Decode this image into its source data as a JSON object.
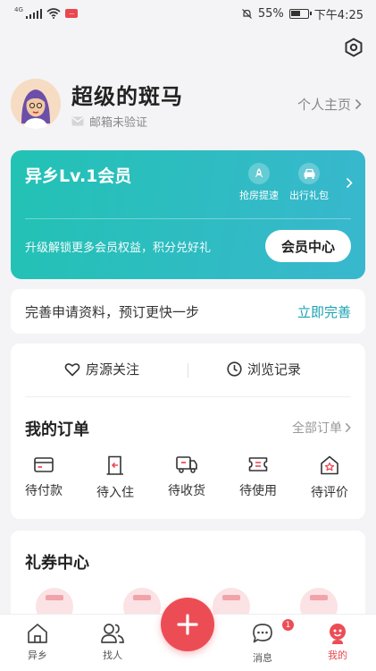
{
  "status_bar": {
    "network": "4G",
    "battery": "55%",
    "time": "下午4:25",
    "app_badge": "—"
  },
  "header": {
    "settings_icon": "hexagon-gear-icon"
  },
  "profile": {
    "nickname": "超级的斑马",
    "email_status": "邮箱未验证",
    "homepage_label": "个人主页"
  },
  "member_card": {
    "title": "异乡Lv.1会员",
    "perks": [
      {
        "label": "抢房提速",
        "icon": "rocket-icon"
      },
      {
        "label": "出行礼包",
        "icon": "car-icon"
      }
    ],
    "subtitle": "升级解锁更多会员权益，积分兑好礼",
    "button_label": "会员中心",
    "colors": {
      "start": "#22c2b4",
      "end": "#39b7ce"
    }
  },
  "profile_completion": {
    "text": "完善申请资料，预订更快一步",
    "action_label": "立即完善",
    "action_color": "#1aa3b4"
  },
  "quick_access": [
    {
      "label": "房源关注",
      "icon": "heart-icon"
    },
    {
      "label": "浏览记录",
      "icon": "clock-icon"
    }
  ],
  "orders": {
    "title": "我的订单",
    "all_label": "全部订单",
    "items": [
      {
        "label": "待付款",
        "icon": "card-icon"
      },
      {
        "label": "待入住",
        "icon": "door-icon"
      },
      {
        "label": "待收货",
        "icon": "truck-icon"
      },
      {
        "label": "待使用",
        "icon": "ticket-icon"
      },
      {
        "label": "待评价",
        "icon": "star-house-icon"
      }
    ]
  },
  "coupons": {
    "title": "礼券中心"
  },
  "tab_bar": {
    "accent": "#ec4d55",
    "tabs": [
      {
        "label": "异乡",
        "icon": "house-icon"
      },
      {
        "label": "找人",
        "icon": "people-icon"
      },
      {
        "label": "",
        "icon": "plus-icon"
      },
      {
        "label": "消息",
        "icon": "chat-icon",
        "badge": "1"
      },
      {
        "label": "我的",
        "icon": "profile-icon",
        "active": true
      }
    ]
  }
}
